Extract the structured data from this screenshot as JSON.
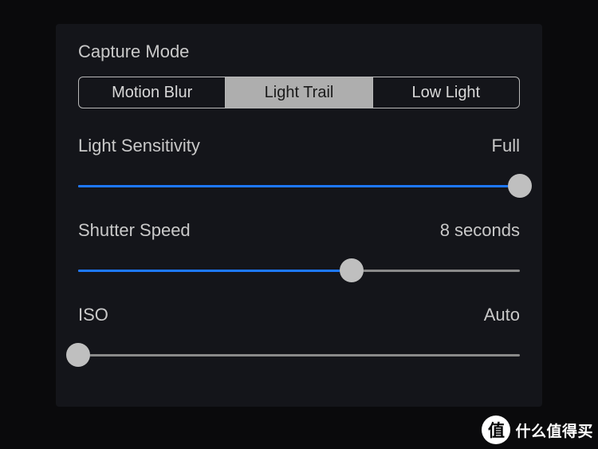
{
  "captureMode": {
    "title": "Capture Mode",
    "options": [
      "Motion Blur",
      "Light Trail",
      "Low Light"
    ],
    "selectedIndex": 1
  },
  "settings": [
    {
      "label": "Light Sensitivity",
      "value": "Full",
      "percent": 100
    },
    {
      "label": "Shutter Speed",
      "value": "8 seconds",
      "percent": 62
    },
    {
      "label": "ISO",
      "value": "Auto",
      "percent": 0
    }
  ],
  "watermark": {
    "badge": "值",
    "text": "什么值得买"
  },
  "colors": {
    "accent": "#1e78ff",
    "trackGray": "#8a8a8a",
    "thumb": "#bfbfbf"
  }
}
